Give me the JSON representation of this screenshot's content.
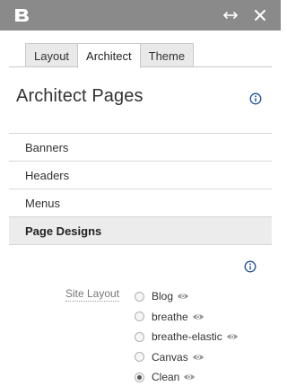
{
  "header": {
    "logo_icon": "brand-b-logo",
    "expand_icon": "horizontal-expand-icon",
    "close_icon": "close-icon"
  },
  "tabs": [
    {
      "label": "Layout",
      "active": false
    },
    {
      "label": "Architect",
      "active": true
    },
    {
      "label": "Theme",
      "active": false
    }
  ],
  "page": {
    "title": "Architect Pages"
  },
  "menu": {
    "items": [
      {
        "label": "Banners",
        "selected": false
      },
      {
        "label": "Headers",
        "selected": false
      },
      {
        "label": "Menus",
        "selected": false
      },
      {
        "label": "Page Designs",
        "selected": true
      }
    ]
  },
  "site_layout": {
    "label": "Site Layout",
    "options": [
      {
        "label": "Blog",
        "checked": false
      },
      {
        "label": "breathe",
        "checked": false
      },
      {
        "label": "breathe-elastic",
        "checked": false
      },
      {
        "label": "Canvas",
        "checked": false
      },
      {
        "label": "Clean",
        "checked": true
      }
    ]
  },
  "colors": {
    "titlebar": "#8a8a8a",
    "info_blue": "#1f4f9b"
  }
}
